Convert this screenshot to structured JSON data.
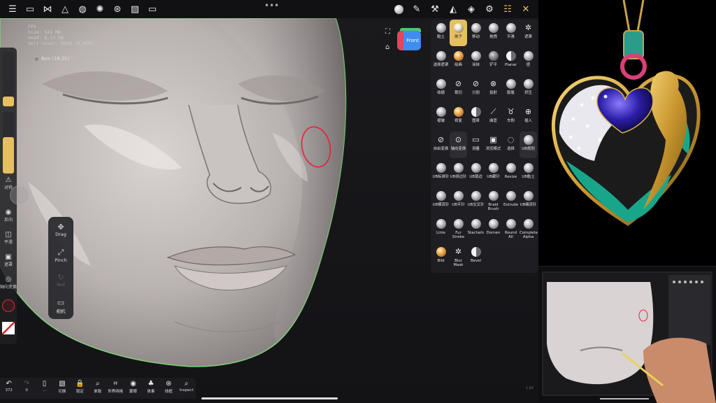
{
  "top_bar": {
    "left_icons": [
      "folder-icon",
      "share-nodes-icon",
      "scene-icon",
      "layers-mesh-icon",
      "light-icon",
      "material-icon",
      "image-icon",
      "camera-icon"
    ],
    "right_icons": [
      "material-sphere-icon",
      "paint-brush-icon",
      "stroke-icon",
      "symmetry-icon",
      "layers-icon",
      "settings-icon",
      "sliders-icon",
      "tools-icon"
    ]
  },
  "stats": {
    "lines": [
      "FPS",
      "Size: 541 MB",
      "Used: 8.13 GB",
      "Vert count: 4834 (0.41M)"
    ]
  },
  "mesh": {
    "label": "Box (16.2k)"
  },
  "view_cube": {
    "label": "Front"
  },
  "left_bar": {
    "items": [
      {
        "icon": "⚠",
        "label": "对称"
      },
      {
        "icon": "◉",
        "label": "反向"
      },
      {
        "icon": "◫",
        "label": "平滑"
      },
      {
        "icon": "▣",
        "label": "遮罩"
      },
      {
        "icon": "◎",
        "label": "轴向变换"
      }
    ]
  },
  "tool_panel": {
    "items": [
      {
        "icon": "✥",
        "label": "Drag"
      },
      {
        "icon": "⤢",
        "label": "Pinch"
      },
      {
        "icon": "↻",
        "label": "Roll"
      },
      {
        "icon": "▭",
        "label": "相机"
      }
    ]
  },
  "bottom_bar": {
    "items": [
      {
        "icon": "↶",
        "label": "372"
      },
      {
        "icon": "↷",
        "label": "0"
      },
      {
        "icon": "▯",
        "label": "..."
      },
      {
        "icon": "▧",
        "label": "切换"
      },
      {
        "icon": "🔒",
        "label": "锁定"
      },
      {
        "icon": "⌕",
        "label": "单致"
      },
      {
        "icon": "⌗",
        "label": "世界网格"
      },
      {
        "icon": "◉",
        "label": "蒙眼"
      },
      {
        "icon": "♣",
        "label": "体素"
      },
      {
        "icon": "⊛",
        "label": "线框"
      },
      {
        "icon": "⌕",
        "label": "Inspect"
      }
    ]
  },
  "palette": {
    "rows": [
      [
        {
          "label": "黏土",
          "kind": "sphere"
        },
        {
          "label": "刷子",
          "kind": "sphere",
          "active": true
        },
        {
          "label": "移动",
          "kind": "sphere"
        },
        {
          "label": "拖拽",
          "kind": "sphere"
        },
        {
          "label": "平滑",
          "kind": "sphere"
        },
        {
          "label": "遮罩",
          "kind": "sym",
          "sym": "✲"
        }
      ],
      [
        {
          "label": "选择遮罩",
          "kind": "sphere"
        },
        {
          "label": "绘画",
          "kind": "sphere-orange"
        },
        {
          "label": "涂抹",
          "kind": "sphere"
        },
        {
          "label": "铲平",
          "kind": "sphere-dark"
        },
        {
          "label": "Planar",
          "kind": "sphere-half"
        },
        {
          "label": "捏",
          "kind": "sphere"
        }
      ],
      [
        {
          "label": "收缩",
          "kind": "sphere"
        },
        {
          "label": "裁切",
          "kind": "sym",
          "sym": "⊘"
        },
        {
          "label": "分割",
          "kind": "sym",
          "sym": "⊘"
        },
        {
          "label": "投射",
          "kind": "sym",
          "sym": "⊗"
        },
        {
          "label": "膨胀",
          "kind": "sphere"
        },
        {
          "label": "挤压",
          "kind": "sphere"
        }
      ],
      [
        {
          "label": "褶皱",
          "kind": "sphere"
        },
        {
          "label": "修复",
          "kind": "sphere-orange"
        },
        {
          "label": "图章",
          "kind": "sphere-half"
        },
        {
          "label": "曲管",
          "kind": "sym",
          "sym": "⟋"
        },
        {
          "label": "车削",
          "kind": "sym",
          "sym": "♉"
        },
        {
          "label": "插入",
          "kind": "sym",
          "sym": "⊕"
        }
      ],
      [
        {
          "label": "自由变换",
          "kind": "sym",
          "sym": "⊘"
        },
        {
          "label": "轴向变换",
          "kind": "sym",
          "sym": "⊙",
          "alt": true
        },
        {
          "label": "测量",
          "kind": "sym",
          "sym": "▭"
        },
        {
          "label": "浏览模式",
          "kind": "sym",
          "sym": "▣"
        },
        {
          "label": "选择",
          "kind": "sym",
          "sym": "◌"
        },
        {
          "label": "UB规划",
          "kind": "sphere",
          "alt": true
        }
      ],
      [
        {
          "label": "UB标准针",
          "kind": "sphere"
        },
        {
          "label": "UB拼边针",
          "kind": "sphere"
        },
        {
          "label": "UB锁边",
          "kind": "sphere"
        },
        {
          "label": "UB藏针",
          "kind": "sphere"
        },
        {
          "label": "Resize",
          "kind": "sphere"
        },
        {
          "label": "UB黏土",
          "kind": "sphere"
        }
      ],
      [
        {
          "label": "UB模流针",
          "kind": "sphere"
        },
        {
          "label": "UB平针",
          "kind": "sphere"
        },
        {
          "label": "UB交叉针",
          "kind": "sphere"
        },
        {
          "label": "Braid Brush",
          "kind": "sphere"
        },
        {
          "label": "Extrude",
          "kind": "sphere"
        },
        {
          "label": "UB绳流针",
          "kind": "sphere"
        }
      ],
      [
        {
          "label": "Linie",
          "kind": "sphere"
        },
        {
          "label": "Fur Stroke",
          "kind": "sphere"
        },
        {
          "label": "Stacheln",
          "kind": "sphere"
        },
        {
          "label": "Dornen",
          "kind": "sphere"
        },
        {
          "label": "Round All",
          "kind": "sphere"
        },
        {
          "label": "Complete Alpha",
          "kind": "sphere"
        }
      ],
      [
        {
          "label": "Bild",
          "kind": "sphere-orange"
        },
        {
          "label": "Blur Mask",
          "kind": "sym",
          "sym": "✲"
        },
        {
          "label": "Bevel",
          "kind": "sphere-half"
        }
      ]
    ]
  },
  "pip": {
    "version": "1.84"
  }
}
